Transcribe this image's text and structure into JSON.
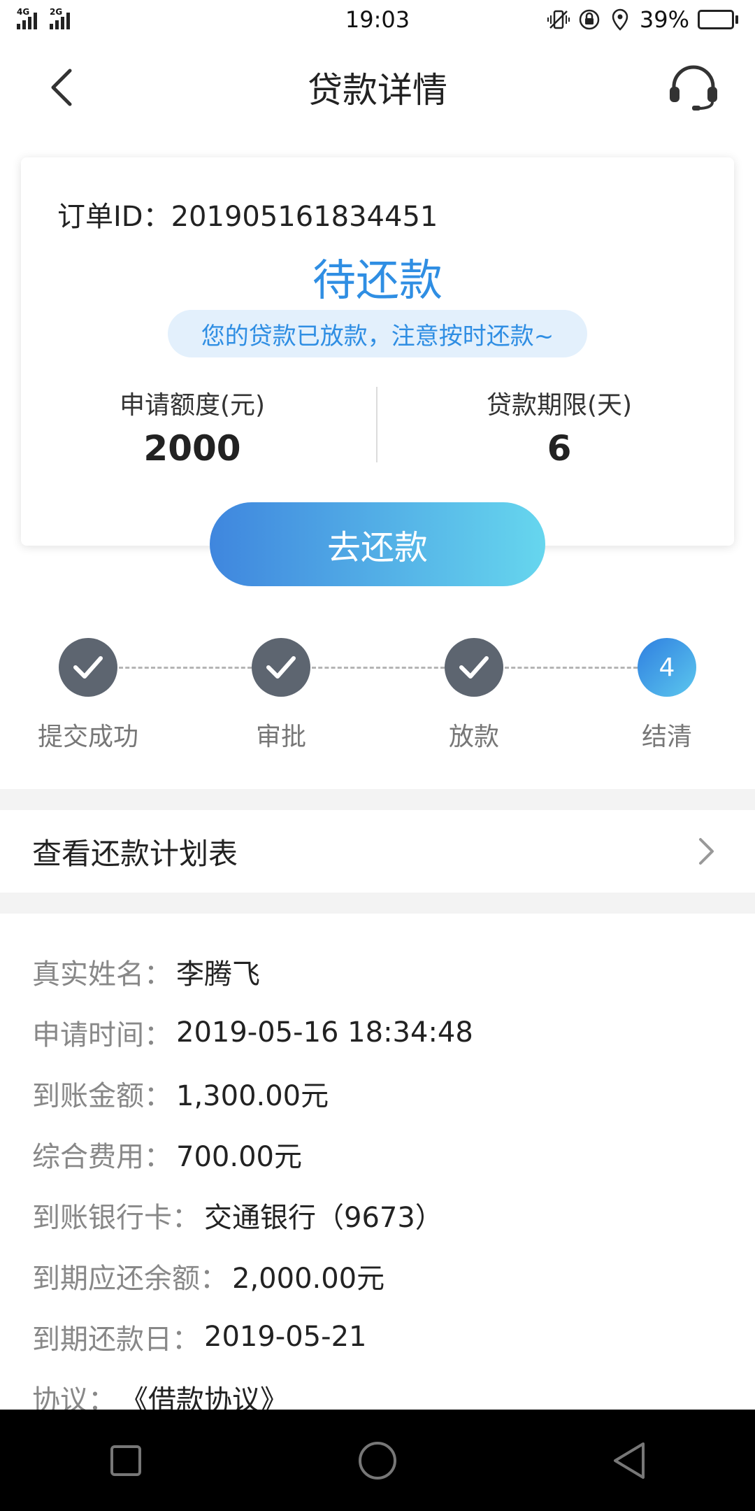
{
  "status_bar": {
    "network_tags": [
      "4G",
      "2G"
    ],
    "time": "19:03",
    "battery": "39%",
    "battery_level": 0.39,
    "icons": [
      "vibrate-icon",
      "rotation-lock-icon",
      "location-icon",
      "battery-icon"
    ]
  },
  "header": {
    "title": "贷款详情",
    "back_icon": "chevron-left-icon",
    "service_icon": "headset-icon"
  },
  "card": {
    "order_label": "订单ID：",
    "order_id": "201905161834451",
    "status": "待还款",
    "notice": "您的贷款已放款，注意按时还款~",
    "amount_label": "申请额度(元)",
    "amount_value": "2000",
    "term_label": "贷款期限(天)",
    "term_value": "6",
    "repay_button": "去还款"
  },
  "steps": [
    {
      "label": "提交成功",
      "state": "done"
    },
    {
      "label": "审批",
      "state": "done"
    },
    {
      "label": "放款",
      "state": "done"
    },
    {
      "label": "结清",
      "state": "current",
      "number": "4"
    }
  ],
  "plan": {
    "label": "查看还款计划表",
    "icon": "chevron-right-icon"
  },
  "info": [
    {
      "key": "真实姓名：",
      "value": "李腾飞"
    },
    {
      "key": "申请时间：",
      "value": "2019-05-16 18:34:48"
    },
    {
      "key": "到账金额：",
      "value": "1,300.00元"
    },
    {
      "key": "综合费用：",
      "value": "700.00元"
    },
    {
      "key": "到账银行卡：",
      "value": "交通银行（9673）"
    },
    {
      "key": "到期应还余额：",
      "value": "2,000.00元"
    },
    {
      "key": "到期还款日：",
      "value": "2019-05-21"
    },
    {
      "key": "协议：",
      "value": "《借款协议》"
    }
  ],
  "colors": {
    "accent": "#2f8ee3",
    "notice_bg": "#e3f0fc",
    "step_done": "#5d6570",
    "button_gradient": [
      "#3f86de",
      "#66d6ee"
    ],
    "battery_fill": "#3ccf3c"
  },
  "nav_bar": [
    "recent-apps-icon",
    "home-icon",
    "back-icon"
  ]
}
